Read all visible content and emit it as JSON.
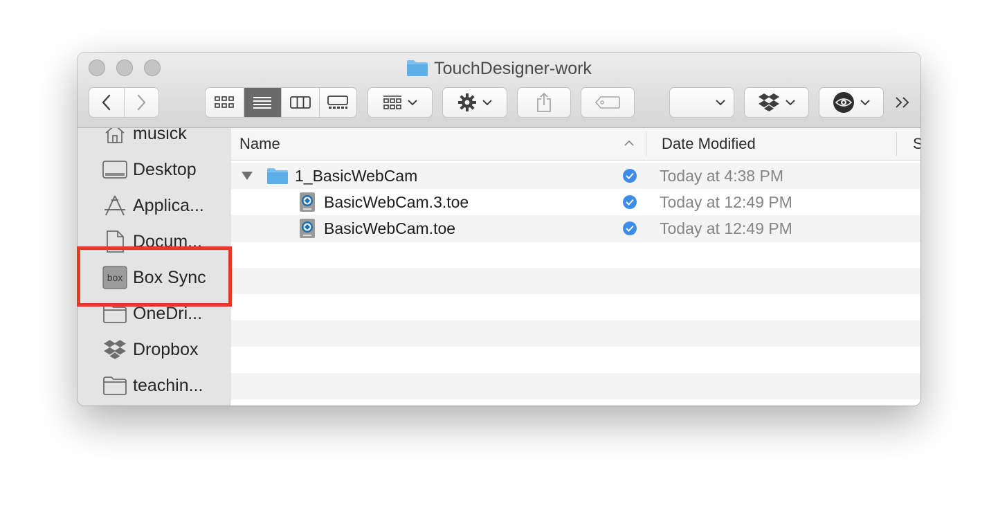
{
  "window": {
    "title": "TouchDesigner-work"
  },
  "toolbar": {
    "back": "‹",
    "forward": "›",
    "overflow": "»"
  },
  "sidebar": {
    "items": [
      {
        "label": "musick",
        "icon": "home-icon"
      },
      {
        "label": "Desktop",
        "icon": "desktop-icon"
      },
      {
        "label": "Applica...",
        "icon": "applications-icon"
      },
      {
        "label": "Docum...",
        "icon": "document-icon"
      },
      {
        "label": "Box Sync",
        "icon": "box-icon",
        "icon_text": "box"
      },
      {
        "label": "OneDri...",
        "icon": "folder-icon"
      },
      {
        "label": "Dropbox",
        "icon": "dropbox-icon"
      },
      {
        "label": "teachin...",
        "icon": "folder-icon"
      }
    ]
  },
  "list": {
    "columns": {
      "name": "Name",
      "date": "Date Modified",
      "size": "S"
    },
    "rows": [
      {
        "name": "1_BasicWebCam",
        "date": "Today at 4:38 PM",
        "type": "folder",
        "synced": true
      },
      {
        "name": "BasicWebCam.3.toe",
        "date": "Today at 12:49 PM",
        "type": "toe-file",
        "synced": true
      },
      {
        "name": "BasicWebCam.toe",
        "date": "Today at 12:49 PM",
        "type": "toe-file",
        "synced": true
      }
    ]
  },
  "colors": {
    "highlight": "#e33c26",
    "folder": "#6fb8ee",
    "check": "#3d8ce8"
  }
}
